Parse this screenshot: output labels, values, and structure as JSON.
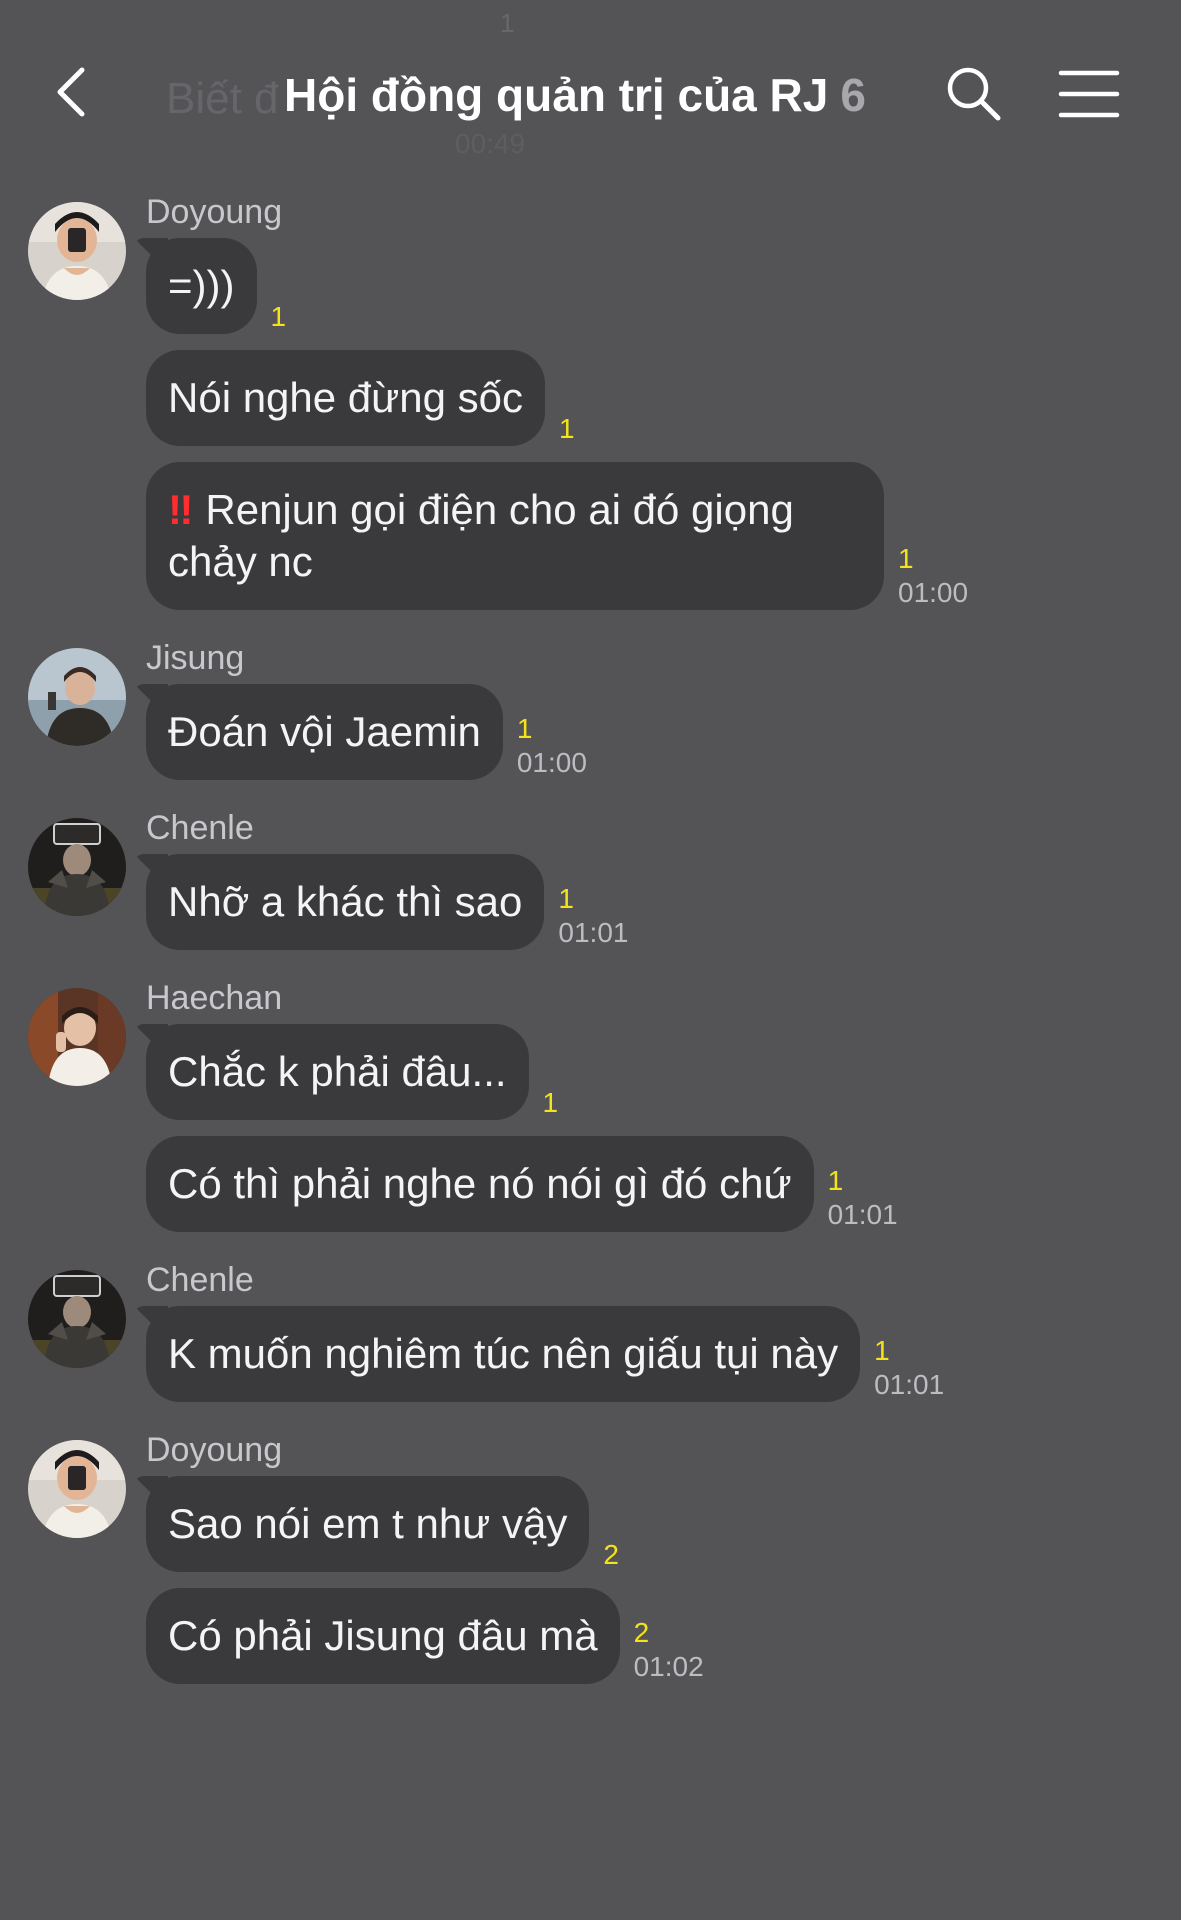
{
  "header": {
    "title": "Hội đồng quản trị của RJ",
    "member_count": "6",
    "ghost_count": "1",
    "ghost_text": "Biết đ",
    "ghost_time": "00:49"
  },
  "colors": {
    "background": "#545356",
    "bubble": "#3a393c",
    "unread": "#f4e21a",
    "alert": "#ff2d2d"
  },
  "groups": [
    {
      "sender": "Doyoung",
      "avatar": "doyoung-avatar",
      "messages": [
        {
          "text": "=)))",
          "unread": "1",
          "time": ""
        },
        {
          "text": "Nói nghe đừng sốc",
          "unread": "1",
          "time": ""
        },
        {
          "prefix": "‼",
          "text": "Renjun gọi điện cho ai đó giọng chảy nc",
          "unread": "1",
          "time": "01:00"
        }
      ]
    },
    {
      "sender": "Jisung",
      "avatar": "jisung-avatar",
      "messages": [
        {
          "text": "Đoán vội Jaemin",
          "unread": "1",
          "time": "01:00"
        }
      ]
    },
    {
      "sender": "Chenle",
      "avatar": "chenle-avatar",
      "messages": [
        {
          "text": "Nhỡ a khác thì sao",
          "unread": "1",
          "time": "01:01"
        }
      ]
    },
    {
      "sender": "Haechan",
      "avatar": "haechan-avatar",
      "messages": [
        {
          "text": "Chắc k phải đâu...",
          "unread": "1",
          "time": ""
        },
        {
          "text": "Có thì phải nghe nó nói gì đó chứ",
          "unread": "1",
          "time": "01:01"
        }
      ]
    },
    {
      "sender": "Chenle",
      "avatar": "chenle-avatar",
      "messages": [
        {
          "text": "K muốn nghiêm túc nên giấu tụi này",
          "unread": "1",
          "time": "01:01"
        }
      ]
    },
    {
      "sender": "Doyoung",
      "avatar": "doyoung-avatar",
      "messages": [
        {
          "text": "Sao nói em t như vậy",
          "unread": "2",
          "time": ""
        },
        {
          "text": "Có phải Jisung đâu mà",
          "unread": "2",
          "time": "01:02"
        }
      ]
    }
  ]
}
